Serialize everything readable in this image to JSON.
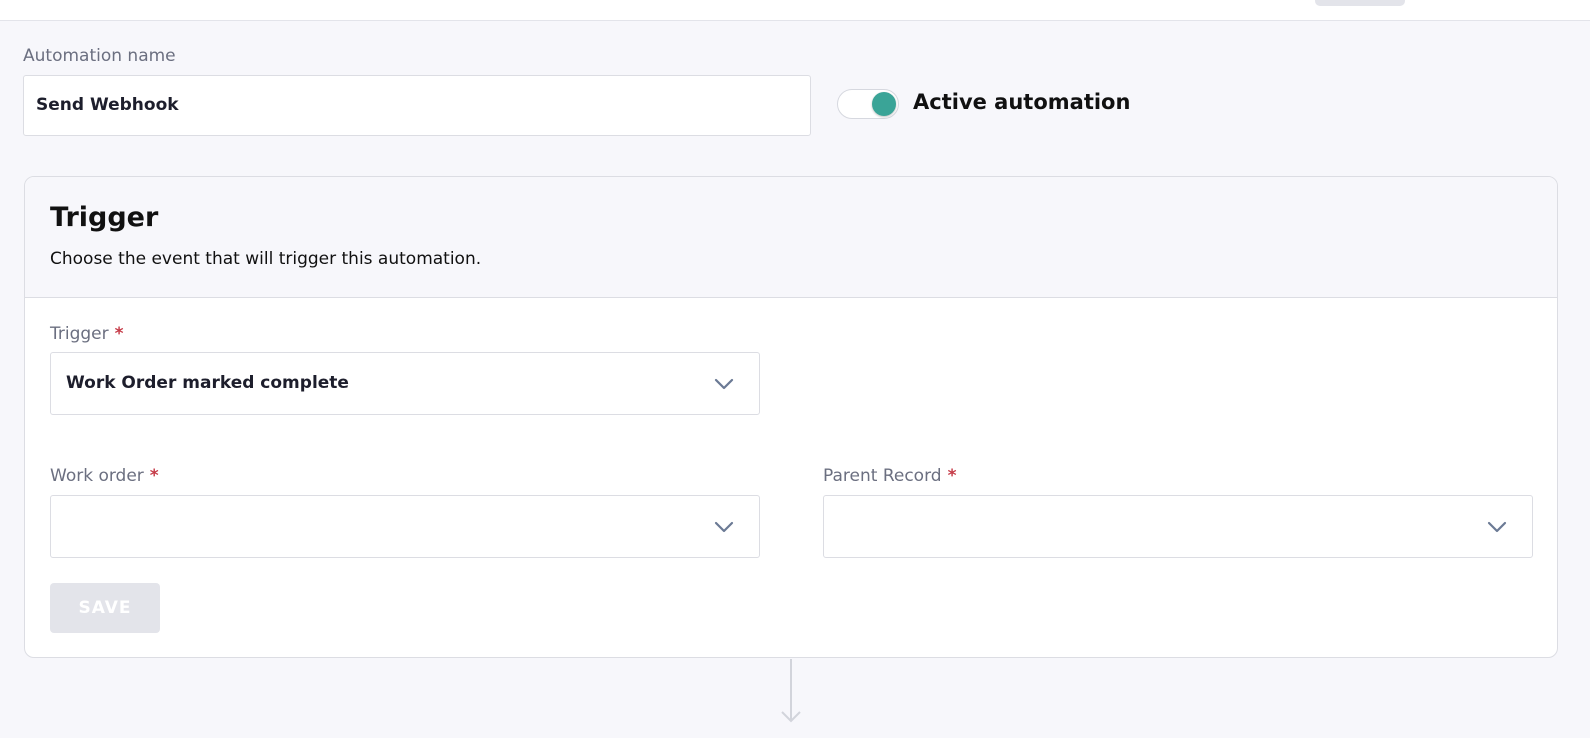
{
  "form": {
    "name_label": "Automation name",
    "name_value": "Send Webhook",
    "active_label": "Active automation",
    "active": true
  },
  "trigger_card": {
    "title": "Trigger",
    "subtitle": "Choose the event that will trigger this automation.",
    "trigger_field": {
      "label": "Trigger",
      "required_mark": "*",
      "value": "Work Order marked complete"
    },
    "work_order_field": {
      "label": "Work order",
      "required_mark": "*",
      "value": ""
    },
    "parent_record_field": {
      "label": "Parent Record",
      "required_mark": "*",
      "value": ""
    },
    "save_label": "SAVE"
  },
  "icons": {
    "toggle": "toggle-on-icon",
    "dropdown": "chevron-down-icon",
    "connector": "arrow-down-icon"
  },
  "colors": {
    "accent": "#3aa497",
    "required": "#c53a47",
    "disabled_button": "#e3e4ea"
  }
}
